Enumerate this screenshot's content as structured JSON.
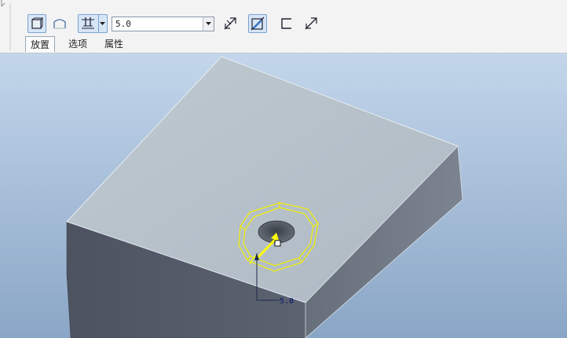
{
  "toolbar": {
    "buttons": [
      {
        "name": "solid-button",
        "icon": "solid-box-icon",
        "active": true
      },
      {
        "name": "surface-button",
        "icon": "surface-icon",
        "active": false
      },
      {
        "name": "depth-option-button",
        "icon": "blind-depth-icon",
        "active": true
      },
      {
        "name": "flip-direction-button",
        "icon": "flip-direction-icon",
        "active": false
      },
      {
        "name": "remove-material-button",
        "icon": "remove-material-icon",
        "active": true
      },
      {
        "name": "thicken-button",
        "icon": "thicken-icon",
        "active": false
      },
      {
        "name": "flip-thicken-button",
        "icon": "flip-thicken-icon",
        "active": false
      }
    ],
    "depth_value": "5.0"
  },
  "tabs": [
    {
      "label": "放置",
      "active": true
    },
    {
      "label": "选项",
      "active": false
    },
    {
      "label": "属性",
      "active": false
    }
  ],
  "viewport": {
    "dimension_label": "5.0",
    "colors": {
      "background_top": "#c3d6eb",
      "background_bottom": "#8aa6c6",
      "top_face": "#b8c3cc",
      "front_face": "#545a66",
      "right_face": "#717a86",
      "preview": "#ffff00"
    }
  }
}
